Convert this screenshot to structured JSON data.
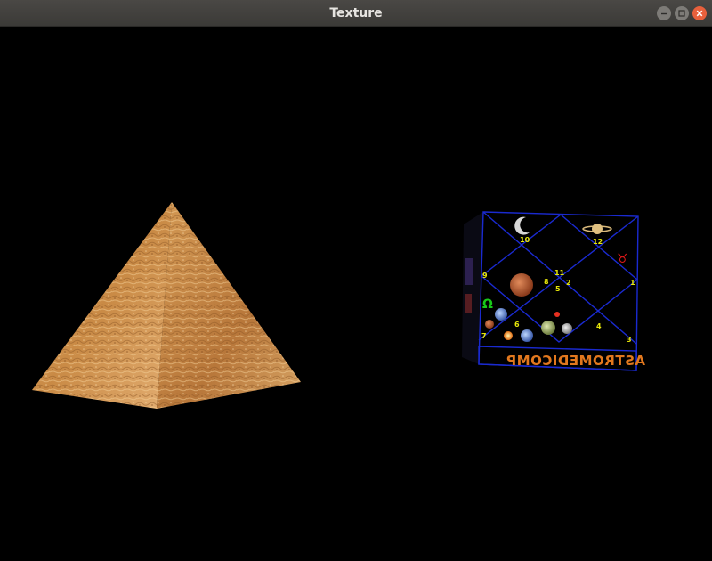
{
  "window": {
    "title": "Texture",
    "controls": {
      "minimize": "minimize-icon",
      "maximize": "maximize-icon",
      "close": "close-icon"
    }
  },
  "scene": {
    "background": "#000000",
    "pyramid": {
      "texture": "sand-texture",
      "colors": [
        "#c88c44",
        "#e0ad6a",
        "#a8692c",
        "#f0c888"
      ]
    },
    "cube": {
      "texture": "astrology-chart",
      "border_color": "#1428c8",
      "banner_text": "ASTROMEDICOMP",
      "banner_color": "#e2781e",
      "house_numbers": [
        "10",
        "12",
        "11",
        "9",
        "8",
        "2",
        "1",
        "7",
        "6",
        "4",
        "3",
        "5"
      ],
      "house_number_color": "#e6e60a",
      "symbols": {
        "omega": "Ω",
        "taurus": "♉"
      }
    }
  }
}
